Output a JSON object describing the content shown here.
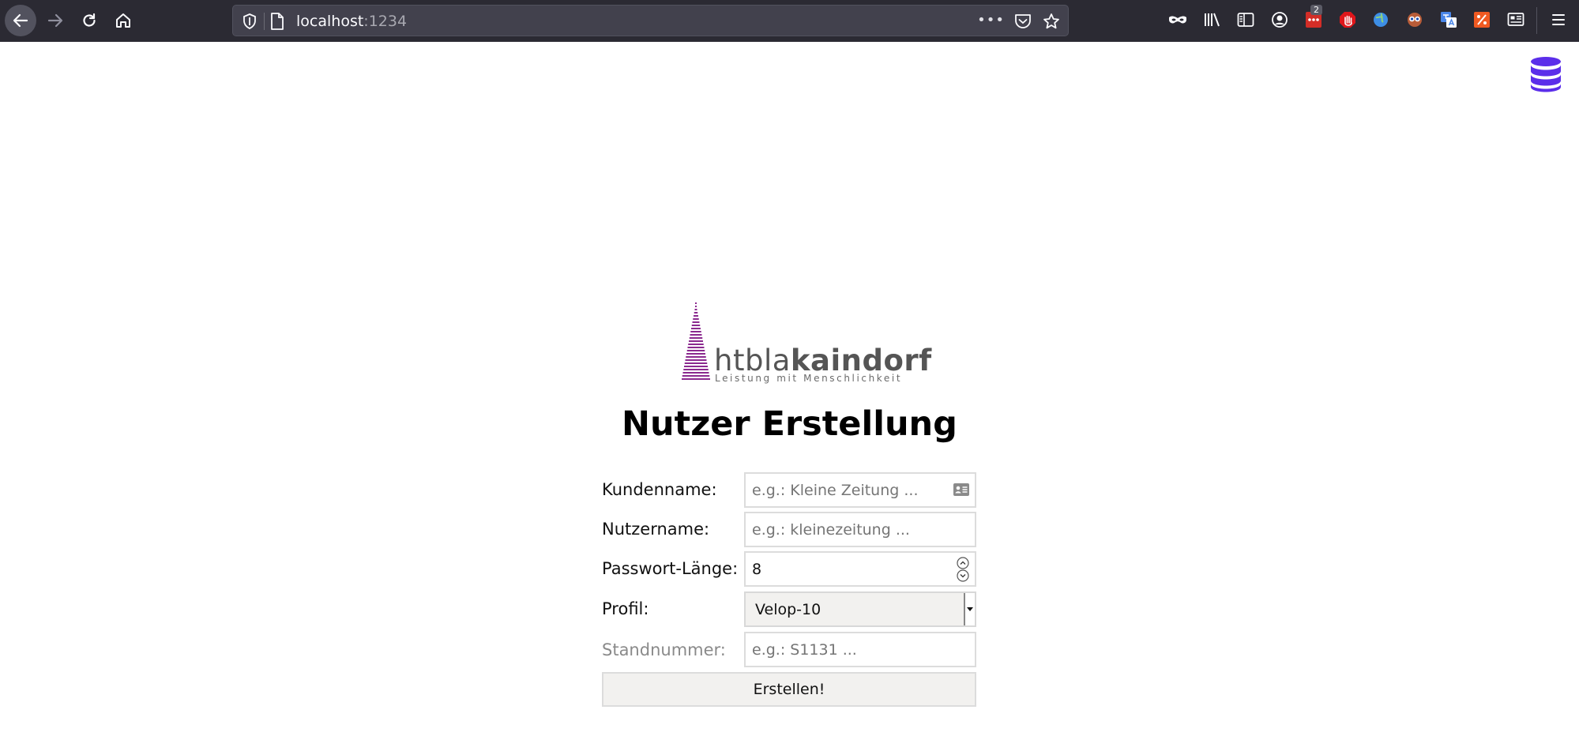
{
  "browser": {
    "url_host": "localhost",
    "url_port": ":1234",
    "more_dots": "•••",
    "extension_badge": "2"
  },
  "logo": {
    "light": "htbla",
    "bold": "kaindorf",
    "tagline": "Leistung mit Menschlichkeit"
  },
  "page": {
    "title": "Nutzer Erstellung"
  },
  "form": {
    "kundenname": {
      "label": "Kundenname:",
      "placeholder": "e.g.: Kleine Zeitung ..."
    },
    "nutzername": {
      "label": "Nutzername:",
      "placeholder": "e.g.: kleinezeitung ..."
    },
    "passwort_laenge": {
      "label": "Passwort-Länge:",
      "value": "8"
    },
    "profil": {
      "label": "Profil:",
      "selected": "Velop-10"
    },
    "standnummer": {
      "label": "Standnummer:",
      "placeholder": "e.g.: S1131 ..."
    },
    "submit_label": "Erstellen!"
  },
  "colors": {
    "toolbar_bg": "#2b2a33",
    "urlbar_bg": "#42414d",
    "logo_purple": "#8b2a8f",
    "db_icon": "#5b2eea"
  }
}
